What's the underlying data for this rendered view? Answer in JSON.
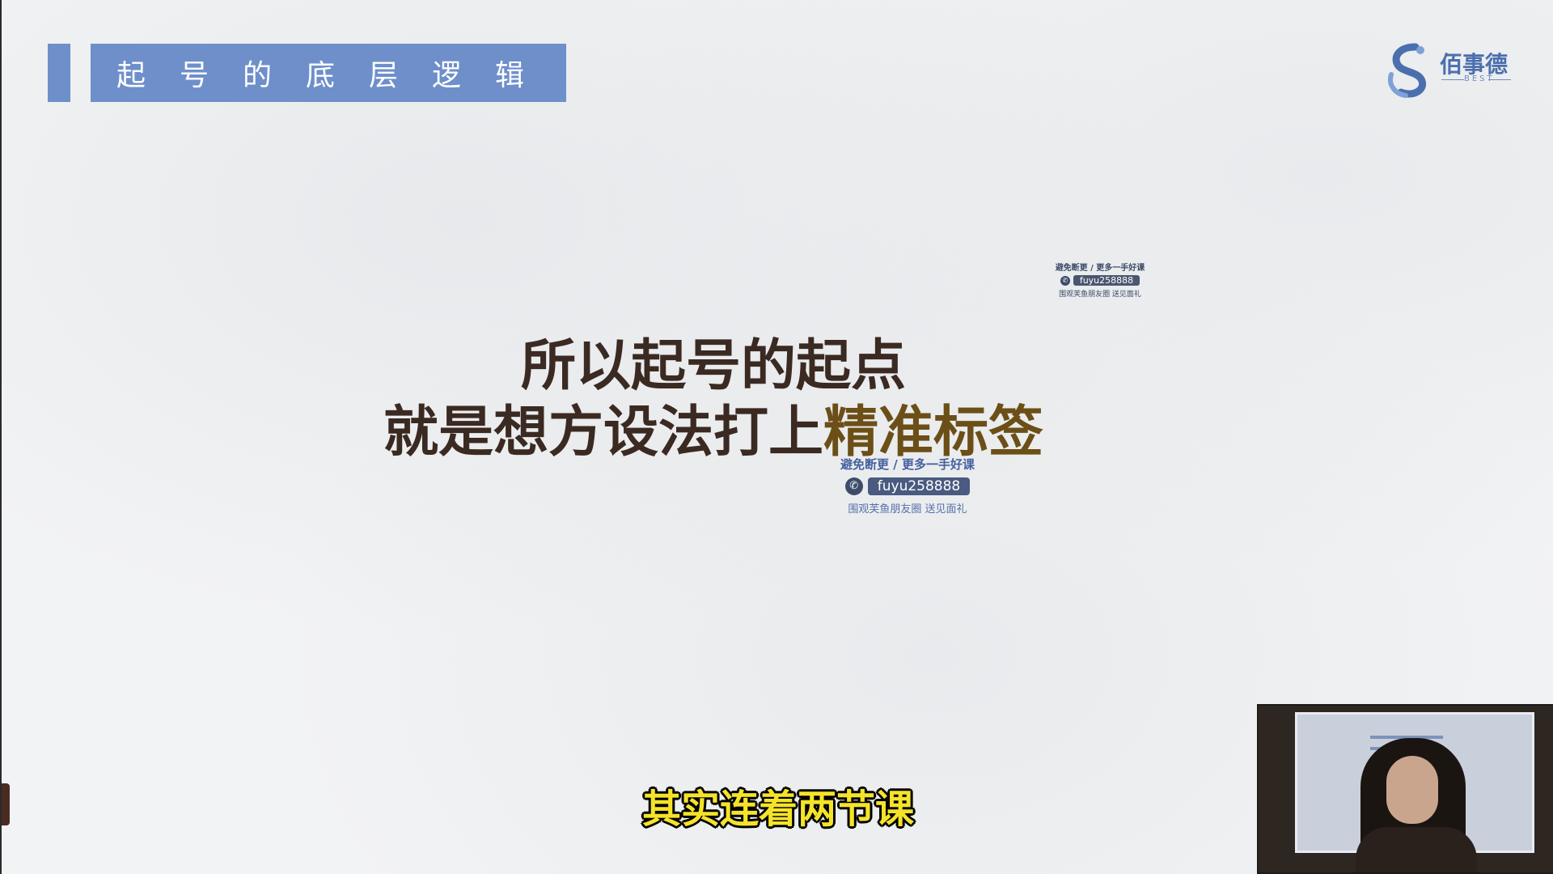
{
  "slide": {
    "title": "起号的底层逻辑",
    "logo": {
      "name": "佰事德",
      "sub": "BEST"
    },
    "main_line1": "所以起号的起点",
    "main_line2_plain": "就是想方设法打上",
    "main_line2_highlight": "精准标签"
  },
  "watermark_small": {
    "line1": "避免断更 / 更多一手好课",
    "handle": "fuyu258888",
    "line3": "围观芙鱼朋友圈 送见面礼"
  },
  "watermark_large": {
    "line1": "避免断更 / 更多一手好课",
    "handle": "fuyu258888",
    "line3": "围观芙鱼朋友圈 送见面礼"
  },
  "subtitle": "其实连着两节课",
  "icons": [
    "wechat-icon",
    "logo-mark-icon"
  ],
  "colors": {
    "title_bar": "#6e8fca",
    "main_text": "#3b2a22",
    "highlight_text": "#6b4f17",
    "subtitle_text": "#f5e32a"
  }
}
